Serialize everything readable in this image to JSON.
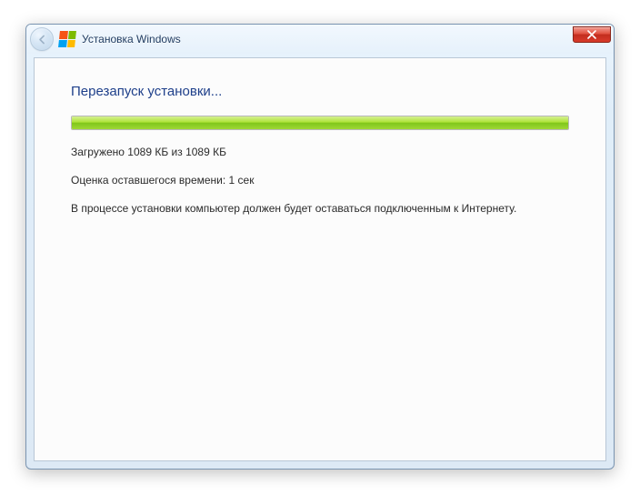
{
  "window": {
    "title": "Установка Windows"
  },
  "heading": "Перезапуск установки...",
  "progress": {
    "downloaded": "Загружено 1089 КБ из 1089 КБ",
    "time_estimate": "Оценка оставшегося времени: 1 сек",
    "note": "В процессе установки компьютер должен будет оставаться подключенным к Интернету."
  }
}
